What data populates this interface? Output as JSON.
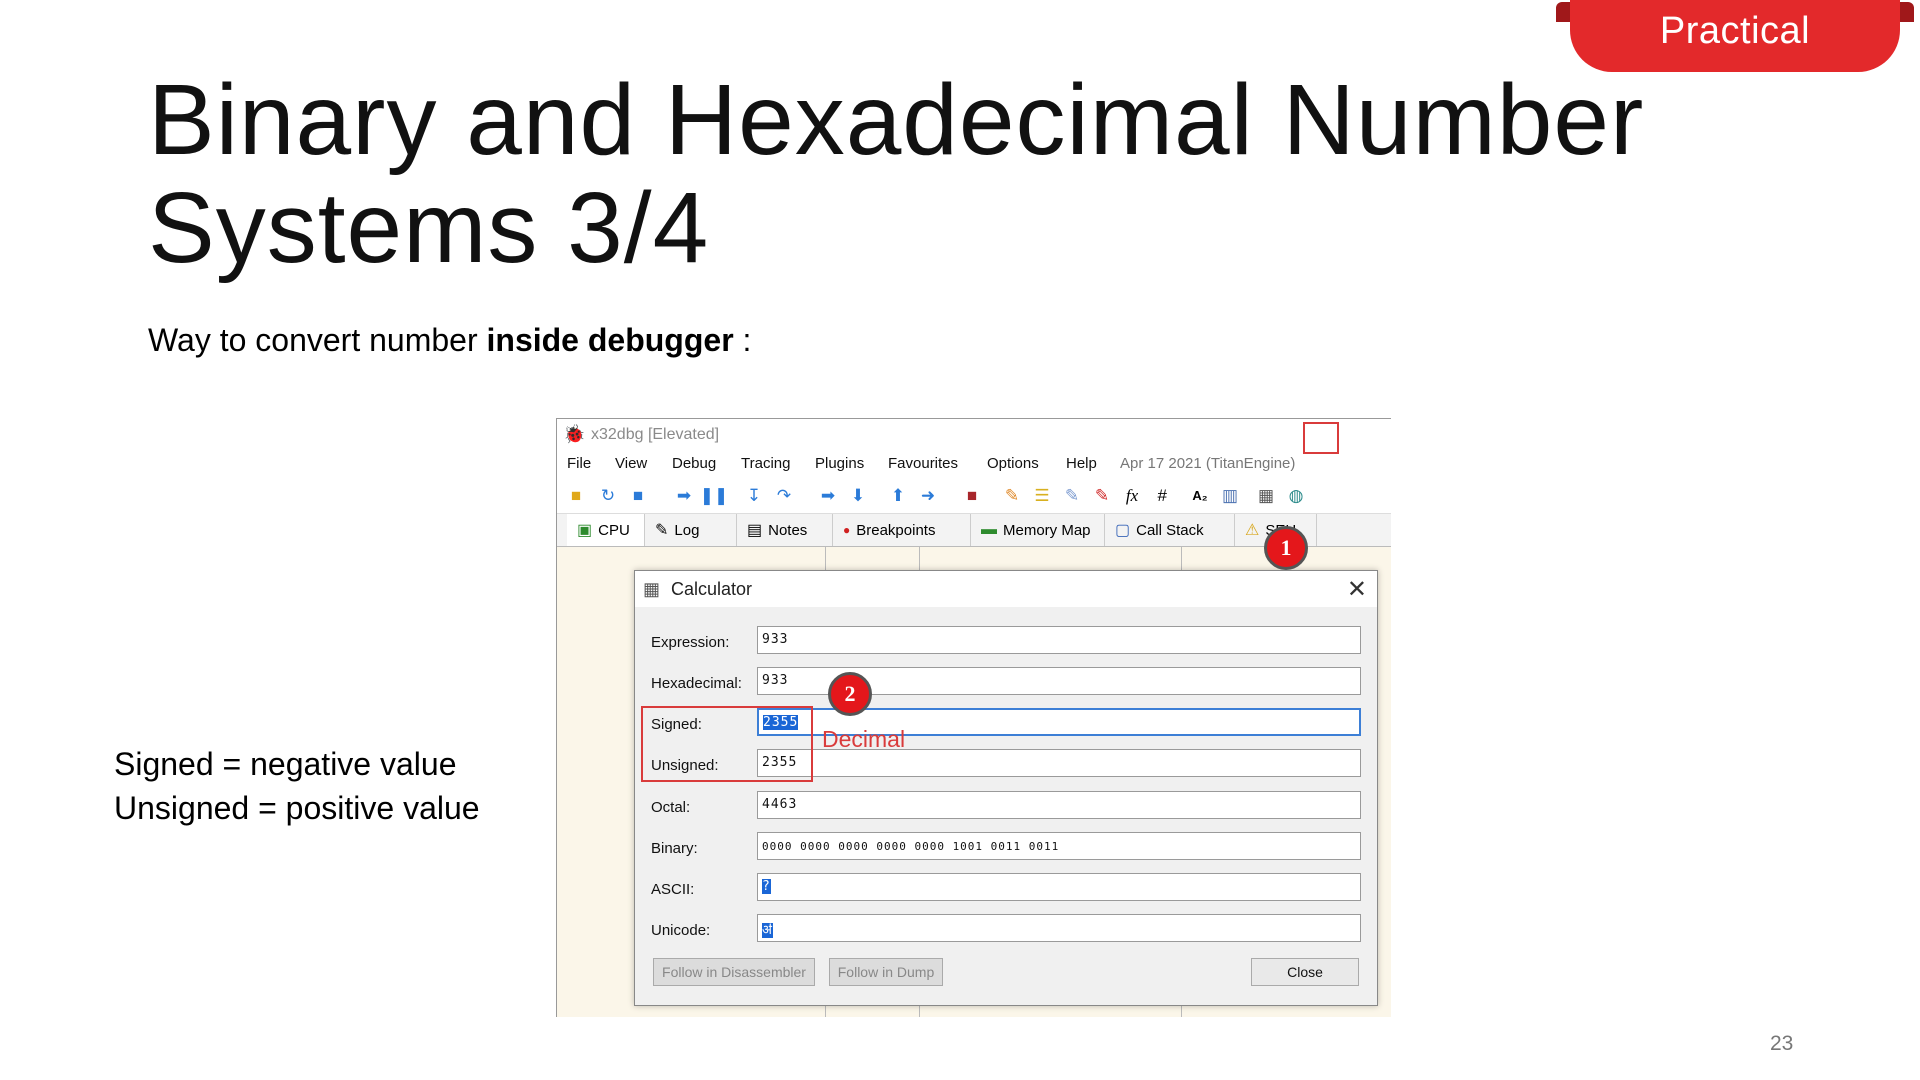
{
  "badge": {
    "label": "Practical"
  },
  "slide": {
    "title_line1": "Binary and Hexadecimal Number",
    "title_line2": "Systems 3/4",
    "subtitle_pre": "Way to convert number ",
    "subtitle_bold": "inside debugger",
    "subtitle_post": " :",
    "note_line1": "Signed = negative value",
    "note_line2": "Unsigned = positive value",
    "page_number": "23"
  },
  "app": {
    "window_title": "x32dbg [Elevated]",
    "menu": [
      "File",
      "View",
      "Debug",
      "Tracing",
      "Plugins",
      "Favourites",
      "Options",
      "Help"
    ],
    "build_info": "Apr 17 2021 (TitanEngine)",
    "tabs": [
      "CPU",
      "Log",
      "Notes",
      "Breakpoints",
      "Memory Map",
      "Call Stack",
      "SEH"
    ]
  },
  "calculator": {
    "title": "Calculator",
    "labels": {
      "expression": "Expression:",
      "hexadecimal": "Hexadecimal:",
      "signed": "Signed:",
      "unsigned": "Unsigned:",
      "octal": "Octal:",
      "binary": "Binary:",
      "ascii": "ASCII:",
      "unicode": "Unicode:"
    },
    "values": {
      "expression": "933",
      "hexadecimal": "933",
      "signed": "2355",
      "unsigned": "2355",
      "octal": "4463",
      "binary": "0000 0000 0000 0000 0000 1001 0011 0011",
      "ascii": "?",
      "unicode": "ॳ"
    },
    "buttons": {
      "follow_disassembler": "Follow in Disassembler",
      "follow_dump": "Follow in Dump",
      "close": "Close"
    }
  },
  "annotations": {
    "step1": "1",
    "step2": "2",
    "decimal": "Decimal"
  }
}
